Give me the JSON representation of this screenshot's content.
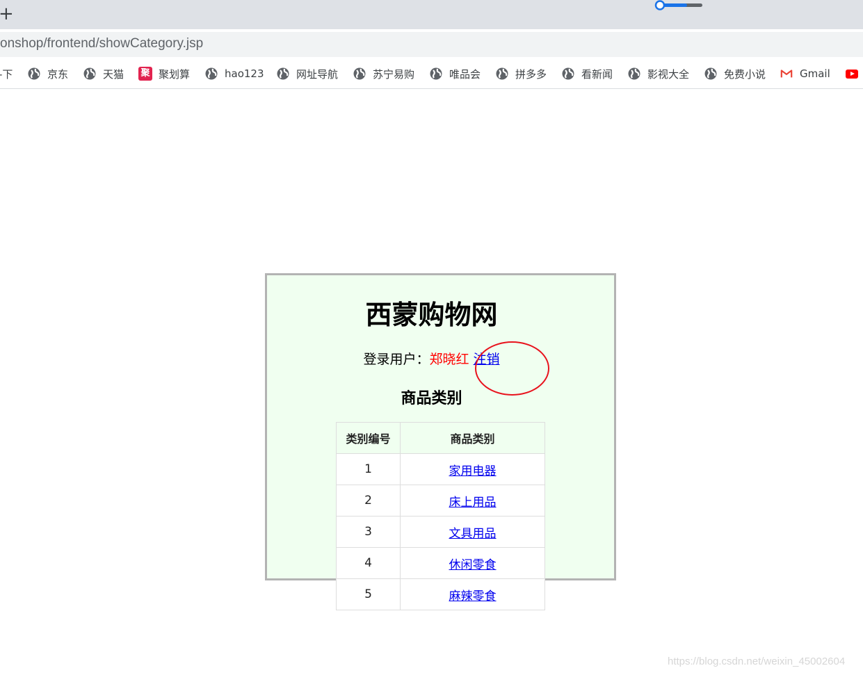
{
  "browser": {
    "url_fragment": "onshop/frontend/showCategory.jsp",
    "bookmarks": [
      {
        "label": "-下",
        "icon": "globe-icon"
      },
      {
        "label": "京东",
        "icon": "globe-icon"
      },
      {
        "label": "天猫",
        "icon": "globe-icon"
      },
      {
        "label": "聚划算",
        "icon": "juhuasuan-icon",
        "icon_text": "聚"
      },
      {
        "label": "hao123",
        "icon": "globe-icon"
      },
      {
        "label": "网址导航",
        "icon": "globe-icon"
      },
      {
        "label": "苏宁易购",
        "icon": "globe-icon"
      },
      {
        "label": "唯品会",
        "icon": "globe-icon"
      },
      {
        "label": "拼多多",
        "icon": "globe-icon"
      },
      {
        "label": "看新闻",
        "icon": "globe-icon"
      },
      {
        "label": "影视大全",
        "icon": "globe-icon"
      },
      {
        "label": "免费小说",
        "icon": "globe-icon"
      },
      {
        "label": "Gmail",
        "icon": "gmail-icon"
      },
      {
        "label": "",
        "icon": "youtube-icon"
      }
    ]
  },
  "page": {
    "site_title": "西蒙购物网",
    "login_prefix": "登录用户：",
    "username": "郑晓红",
    "logout_label": "注销",
    "section_title": "商品类别",
    "table": {
      "headers": [
        "类别编号",
        "商品类别"
      ],
      "rows": [
        {
          "id": "1",
          "name": "家用电器"
        },
        {
          "id": "2",
          "name": "床上用品"
        },
        {
          "id": "3",
          "name": "文具用品"
        },
        {
          "id": "4",
          "name": "休闲零食"
        },
        {
          "id": "5",
          "name": "麻辣零食"
        }
      ]
    }
  },
  "watermark": "https://blog.csdn.net/weixin_45002604",
  "colors": {
    "panel_background": "#f0fff0",
    "username": "#ff0000",
    "link": "#0000ee",
    "annotation_circle": "#e8121c"
  }
}
